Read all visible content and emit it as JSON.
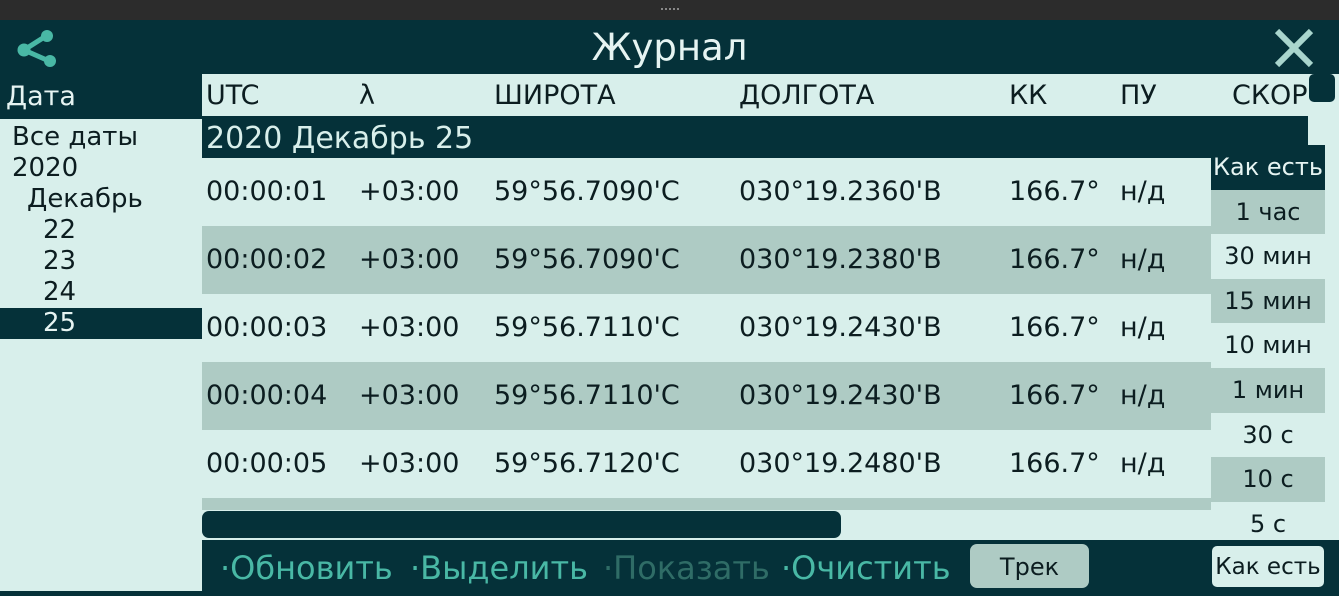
{
  "window": {
    "title": "Журнал"
  },
  "sidebar": {
    "header": "Дата",
    "items": [
      {
        "label": "Все даты",
        "level": 0
      },
      {
        "label": "2020",
        "level": 0
      },
      {
        "label": "Декабрь",
        "level": 1
      },
      {
        "label": "22",
        "level": 2
      },
      {
        "label": "23",
        "level": 2
      },
      {
        "label": "24",
        "level": 2
      },
      {
        "label": "25",
        "level": 2,
        "selected": true
      }
    ]
  },
  "table": {
    "columns": [
      "UTC",
      "λ",
      "ШИРОТА",
      "ДОЛГОТА",
      "КК",
      "ПУ",
      "СКОР"
    ],
    "group": "2020 Декабрь 25",
    "rows": [
      [
        "00:00:01",
        "+03:00",
        "59°56.7090'С",
        "030°19.2360'В",
        "166.7°",
        "н/д"
      ],
      [
        "00:00:02",
        "+03:00",
        "59°56.7090'С",
        "030°19.2380'В",
        "166.7°",
        "н/д"
      ],
      [
        "00:00:03",
        "+03:00",
        "59°56.7110'С",
        "030°19.2430'В",
        "166.7°",
        "н/д"
      ],
      [
        "00:00:04",
        "+03:00",
        "59°56.7110'С",
        "030°19.2430'В",
        "166.7°",
        "н/д"
      ],
      [
        "00:00:05",
        "+03:00",
        "59°56.7120'С",
        "030°19.2480'В",
        "166.7°",
        "н/д"
      ]
    ]
  },
  "interval_dropdown": {
    "options": [
      "Как есть",
      "1 час",
      "30 мин",
      "15 мин",
      "10 мин",
      "1 мин",
      "30 с",
      "10 с",
      "5 с"
    ],
    "selected": "Как есть"
  },
  "footer": {
    "refresh": "·Обновить",
    "select": "·Выделить",
    "show": "·Показать",
    "clear": "·Очистить",
    "track": "Трек",
    "interval": "Как есть"
  },
  "icons": {
    "share": "share-icon",
    "close": "close-icon"
  },
  "colors": {
    "dark": "#053139",
    "light": "#d8efeb",
    "alt": "#aecbc4",
    "accent": "#49b8a5"
  }
}
